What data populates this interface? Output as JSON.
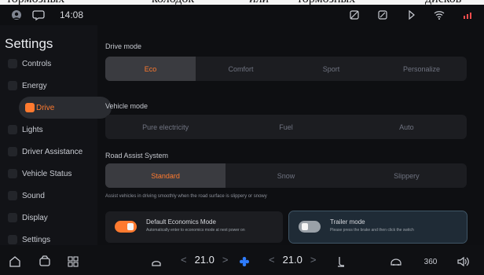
{
  "overlay": {
    "top_text_1": "тормозных",
    "top_text_2": "колодок",
    "top_text_3": "или",
    "top_text_4": "тормозных",
    "top_text_5": "дисков"
  },
  "status": {
    "time": "14:08"
  },
  "sidebar": {
    "title": "Settings",
    "items": [
      {
        "label": "Controls"
      },
      {
        "label": "Energy"
      },
      {
        "label": "Drive"
      },
      {
        "label": "Lights"
      },
      {
        "label": "Driver Assistance"
      },
      {
        "label": "Vehicle Status"
      },
      {
        "label": "Sound"
      },
      {
        "label": "Display"
      },
      {
        "label": "Settings"
      }
    ]
  },
  "drive_mode": {
    "title": "Drive mode",
    "options": [
      "Eco",
      "Comfort",
      "Sport",
      "Personalize"
    ],
    "selected": "Eco"
  },
  "vehicle_mode": {
    "title": "Vehicle mode",
    "options": [
      "Pure electricity",
      "Fuel",
      "Auto"
    ],
    "selected": null
  },
  "road_assist": {
    "title": "Road Assist System",
    "options": [
      "Standard",
      "Snow",
      "Slippery"
    ],
    "selected": "Standard",
    "hint": "Assist vehicles in driving smoothly when the road surface is slippery or snowy"
  },
  "cards": {
    "economics": {
      "title": "Default Economics Mode",
      "subtitle": "Automatically enter to economics mode at next power on",
      "enabled": true
    },
    "trailer": {
      "title": "Trailer mode",
      "subtitle": "Please press the brake and then click the switch",
      "enabled": false
    }
  },
  "bottom": {
    "temp_left": "21.0",
    "temp_right": "21.0",
    "chev_left": "<",
    "chev_right": ">",
    "chev_left_2": "<",
    "chev_right_2": ">",
    "badge_360": "360"
  },
  "colors": {
    "accent": "#ff7a2f",
    "panel": "#1c1d21",
    "blue_card": "#1f2b36"
  }
}
